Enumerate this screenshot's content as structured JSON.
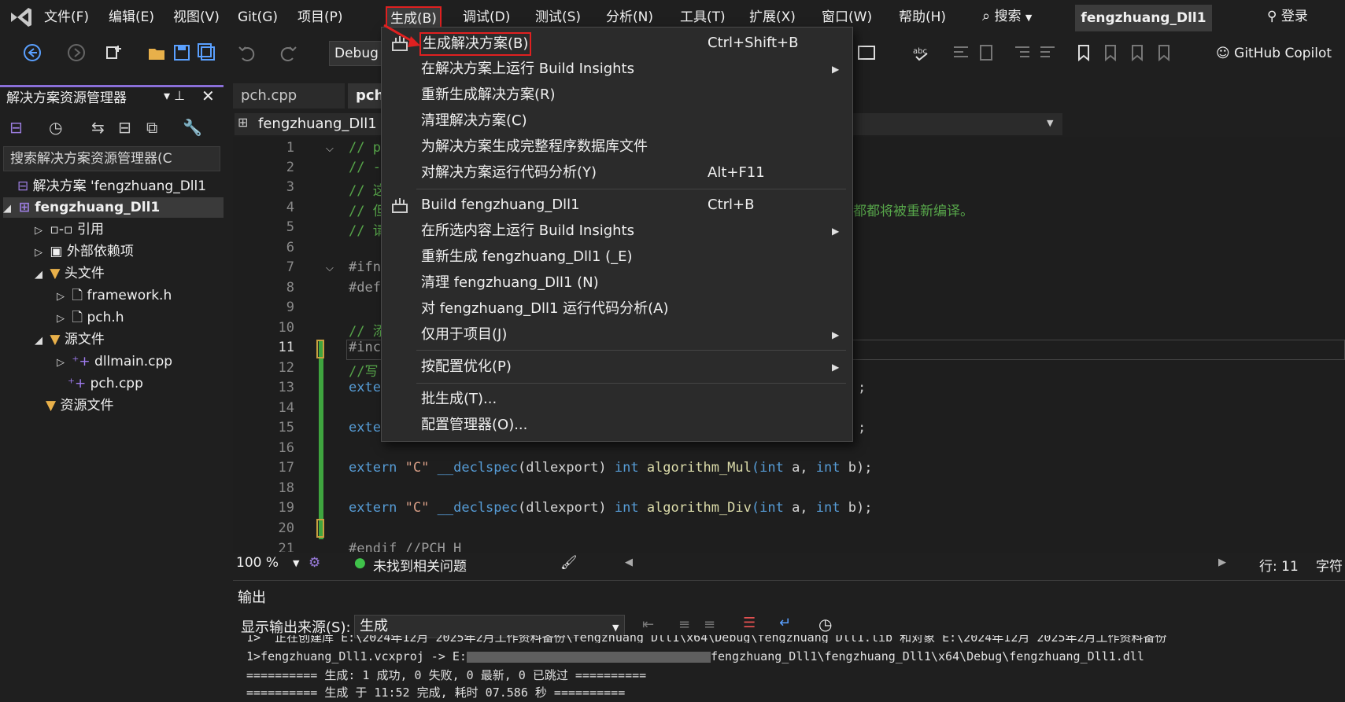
{
  "menubar": {
    "items": [
      "文件(F)",
      "编辑(E)",
      "视图(V)",
      "Git(G)",
      "项目(P)",
      "生成(B)",
      "调试(D)",
      "测试(S)",
      "分析(N)",
      "工具(T)",
      "扩展(X)",
      "窗口(W)",
      "帮助(H)"
    ],
    "search": "搜索",
    "solution_name": "fengzhuang_Dll1",
    "login": "登录"
  },
  "toolbar": {
    "config": "Debug",
    "copilot": "GitHub Copilot"
  },
  "solution_explorer": {
    "title": "解决方案资源管理器",
    "search_placeholder": "搜索解决方案资源管理器(C",
    "solution": "解决方案 'fengzhuang_Dll1",
    "project": "fengzhuang_Dll1",
    "references": "引用",
    "external_deps": "外部依赖项",
    "headers": "头文件",
    "framework_h": "framework.h",
    "pch_h": "pch.h",
    "sources": "源文件",
    "dllmain_cpp": "dllmain.cpp",
    "pch_cpp": "pch.cpp",
    "resources": "资源文件"
  },
  "editor": {
    "tabs": [
      "pch.cpp",
      "pch"
    ],
    "nav_project": "fengzhuang_Dll1",
    "line_numbers": [
      "1",
      "2",
      "3",
      "4",
      "5",
      "6",
      "7",
      "8",
      "9",
      "10",
      "11",
      "12",
      "13",
      "14",
      "15",
      "16",
      "17",
      "18",
      "19",
      "20",
      "21"
    ],
    "visible_fragments": {
      "l1": "// p",
      "l2": "// -",
      "l3": "// 这",
      "l4": "// 但",
      "l4_tail": "都都将被重新编译。",
      "l5": "// 请",
      "l7": "#ifn",
      "l8": "#def",
      "l10": "// 添",
      "l11": "#inc",
      "l12": "//写",
      "l13": "exte",
      "l15": "exte",
      "l13_tail": ";",
      "l15_tail": ";",
      "l21": "#endif //PCH_H"
    },
    "line17": {
      "extern": "extern",
      "c": "\"C\"",
      "decl": "__declspec",
      "open": "(dllexport)",
      "int": "int",
      "name": "algorithm_Mul",
      "p1": "(int",
      "a": " a, ",
      "p2": "int",
      "b": " b);"
    },
    "line19": {
      "extern": "extern",
      "c": "\"C\"",
      "decl": "__declspec",
      "open": "(dllexport)",
      "int": "int",
      "name": "algorithm_Div",
      "p1": "(int",
      "a": " a, ",
      "p2": "int",
      "b": " b);"
    },
    "status": {
      "zoom": "100 %",
      "issues": "未找到相关问题",
      "line": "行: 11",
      "char": "字符"
    }
  },
  "output": {
    "title": "输出",
    "source_label": "显示输出来源(S):",
    "source_value": "生成",
    "lines": [
      "1>  正在创建库 E:\\2024年12月 2025年2月工作资料备份\\fengzhuang_Dll1\\x64\\Debug\\fengzhuang_Dll1.lib 和对象 E:\\2024年12月 2025年2月工作资料备份",
      "1>fengzhuang_Dll1.vcxproj -> E:",
      "fengzhuang_Dll1\\fengzhuang_Dll1\\x64\\Debug\\fengzhuang_Dll1.dll",
      "========== 生成: 1 成功, 0 失败, 0 最新, 0 已跳过 ==========",
      "========== 生成 于 11:52 完成, 耗时 07.586 秒 =========="
    ]
  },
  "build_menu": {
    "items": [
      {
        "label": "生成解决方案(B)",
        "shortcut": "Ctrl+Shift+B"
      },
      {
        "label": "在解决方案上运行 Build Insights",
        "shortcut": ""
      },
      {
        "label": "重新生成解决方案(R)",
        "shortcut": ""
      },
      {
        "label": "清理解决方案(C)",
        "shortcut": ""
      },
      {
        "label": "为解决方案生成完整程序数据库文件",
        "shortcut": ""
      },
      {
        "label": "对解决方案运行代码分析(Y)",
        "shortcut": "Alt+F11"
      },
      {
        "label": "Build fengzhuang_Dll1",
        "shortcut": "Ctrl+B"
      },
      {
        "label": "在所选内容上运行 Build Insights",
        "shortcut": ""
      },
      {
        "label": "重新生成 fengzhuang_Dll1 (_E)",
        "shortcut": ""
      },
      {
        "label": "清理 fengzhuang_Dll1 (N)",
        "shortcut": ""
      },
      {
        "label": "对 fengzhuang_Dll1 运行代码分析(A)",
        "shortcut": ""
      },
      {
        "label": "仅用于项目(J)",
        "shortcut": ""
      },
      {
        "label": "按配置优化(P)",
        "shortcut": ""
      },
      {
        "label": "批生成(T)...",
        "shortcut": ""
      },
      {
        "label": "配置管理器(O)...",
        "shortcut": ""
      }
    ]
  },
  "colors": {
    "accent_purple": "#8a6fd8",
    "highlight_red": "#e02020",
    "keyword_blue": "#569cd6",
    "comment_green": "#57a64a",
    "change_bar_green": "#3fa53f"
  }
}
